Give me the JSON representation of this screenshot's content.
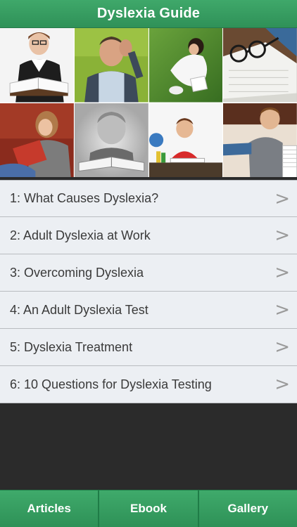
{
  "app": {
    "title": "Dyslexia Guide"
  },
  "gallery": {
    "photos": [
      {
        "icon": "woman-reading-book"
      },
      {
        "icon": "man-headache"
      },
      {
        "icon": "girl-reading-on-grass"
      },
      {
        "icon": "glasses-on-book"
      },
      {
        "icon": "girl-reading-on-couch"
      },
      {
        "icon": "boy-reading-bw"
      },
      {
        "icon": "boy-reading-at-desk"
      },
      {
        "icon": "boy-with-books"
      }
    ]
  },
  "articles": [
    {
      "label": "1: What Causes Dyslexia?"
    },
    {
      "label": "2: Adult Dyslexia at Work"
    },
    {
      "label": "3: Overcoming Dyslexia"
    },
    {
      "label": "4: An Adult Dyslexia Test"
    },
    {
      "label": "5: Dyslexia Treatment"
    },
    {
      "label": "6: 10 Questions for Dyslexia Testing"
    }
  ],
  "chevron": ">",
  "tabs": [
    {
      "label": "Articles"
    },
    {
      "label": "Ebook"
    },
    {
      "label": "Gallery"
    }
  ],
  "colors": {
    "brand_green": "#35a063",
    "list_bg": "#eceff3",
    "background": "#2b2b2b"
  }
}
